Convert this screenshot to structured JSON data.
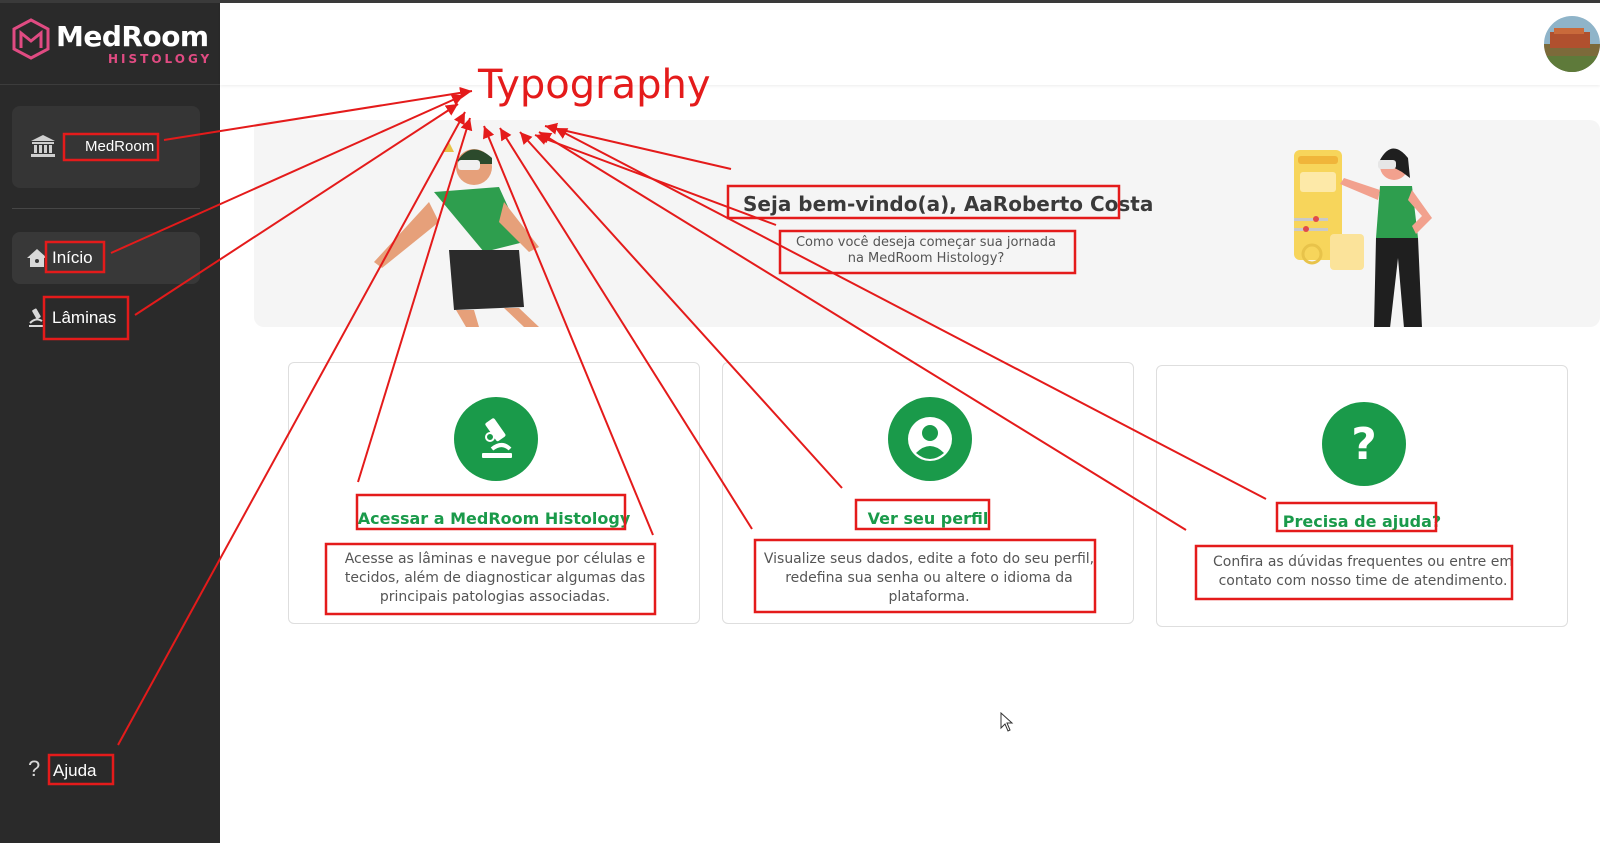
{
  "app": {
    "brand": "MedRoom",
    "brand_sub": "HISTOLOGY"
  },
  "sidebar": {
    "org": {
      "label": "MedRoom",
      "icon": "institution-icon"
    },
    "items": [
      {
        "label": "Início",
        "icon": "home-icon",
        "active": true
      },
      {
        "label": "Lâminas",
        "icon": "microscope-icon",
        "active": false
      }
    ],
    "help": {
      "label": "Ajuda",
      "icon": "question-icon"
    }
  },
  "banner": {
    "welcome": "Seja bem-vindo(a), AaRoberto Costa",
    "subtitle": "Como você deseja começar sua jornada na MedRoom Histology?"
  },
  "cards": [
    {
      "title": "Acessar a MedRoom Histology",
      "description": "Acesse as lâminas e navegue por células e tecidos, além de diagnosticar algumas das principais patologias associadas.",
      "icon": "microscope-icon"
    },
    {
      "title": "Ver seu perfil",
      "description": "Visualize seus dados, edite a foto do seu perfil, redefina sua senha ou altere o idioma da plataforma.",
      "icon": "user-icon"
    },
    {
      "title": "Precisa de ajuda?",
      "description": "Confira as dúvidas frequentes ou entre em contato com nosso time de atendimento.",
      "icon": "question-icon"
    }
  ],
  "annotation": {
    "label": "Typography",
    "color": "#e41b1b"
  },
  "colors": {
    "sidebar_bg": "#2a2a2a",
    "accent_green": "#1a9a4a",
    "brand_pink": "#e04b82"
  }
}
